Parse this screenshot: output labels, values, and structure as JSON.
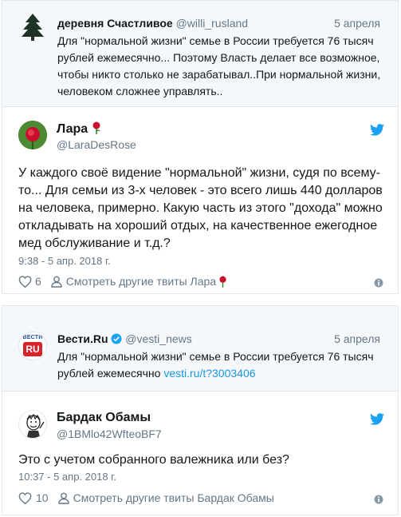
{
  "tweet1": {
    "quoted": {
      "name": "деревня Счастливое",
      "handle": "@willi_rusland",
      "date": "5 апреля",
      "lines": [
        "Для \"нормальной жизни\" семье в России требуется 76 тысяч",
        "рублей ежемесячно... Поэтому Власть делает все возможное,",
        "чтобы никто столько не зарабатывал..При нормальной жизни,",
        "человеком сложнее управлять.."
      ]
    },
    "author": {
      "name": "Лара",
      "handle": "@LaraDesRose"
    },
    "lines": [
      "У каждого своё видение \"нормальной\" жизни, судя по всему-",
      "то... Для семьи из 3-х человек - это всего лишь 440 долларов",
      "на человека, примерно. Какую часть из этого \"дохода\" можно",
      "откладывать на хороший отдых, на качественное ежегодное",
      "мед обслуживание и т.д.?"
    ],
    "timestamp": "9:38 - 5 апр. 2018 г.",
    "likes": "6",
    "more_label": "Смотреть другие твиты Лара"
  },
  "tweet2": {
    "quoted": {
      "name": "Вести.Ru",
      "handle": "@vesti_news",
      "date": "5 апреля",
      "lines": [
        "Для \"нормальной жизни\" семье в России требуется 76 тысяч"
      ],
      "line2_text": "рублей ежемесячно ",
      "link": "vesti.ru/t?3003406",
      "avatar_text_top": "ВЕСТИ",
      "avatar_text_main": "RU"
    },
    "author": {
      "name": "Бардак Обамы",
      "handle": "@1BMlo42WfteoBF7"
    },
    "lines": [
      "Это с учетом собранного валежника или без?"
    ],
    "timestamp": "10:37 - 5 апр. 2018 г.",
    "likes": "10",
    "more_label": "Смотреть другие твиты Бардак Обамы"
  },
  "colors": {
    "link": "#1b95e0",
    "secondary": "#657786",
    "border": "#e1e8ed",
    "quote_bg": "#f5f8fa",
    "rose": "#c8102e",
    "tree": "#1f3327",
    "vesti_red": "#d7232a"
  },
  "icons": [
    "tree-avatar",
    "rose-icon",
    "twitter-bird-icon",
    "heart-icon",
    "person-icon",
    "info-icon",
    "verified-badge-icon",
    "vesti-logo",
    "meme-avatar"
  ]
}
